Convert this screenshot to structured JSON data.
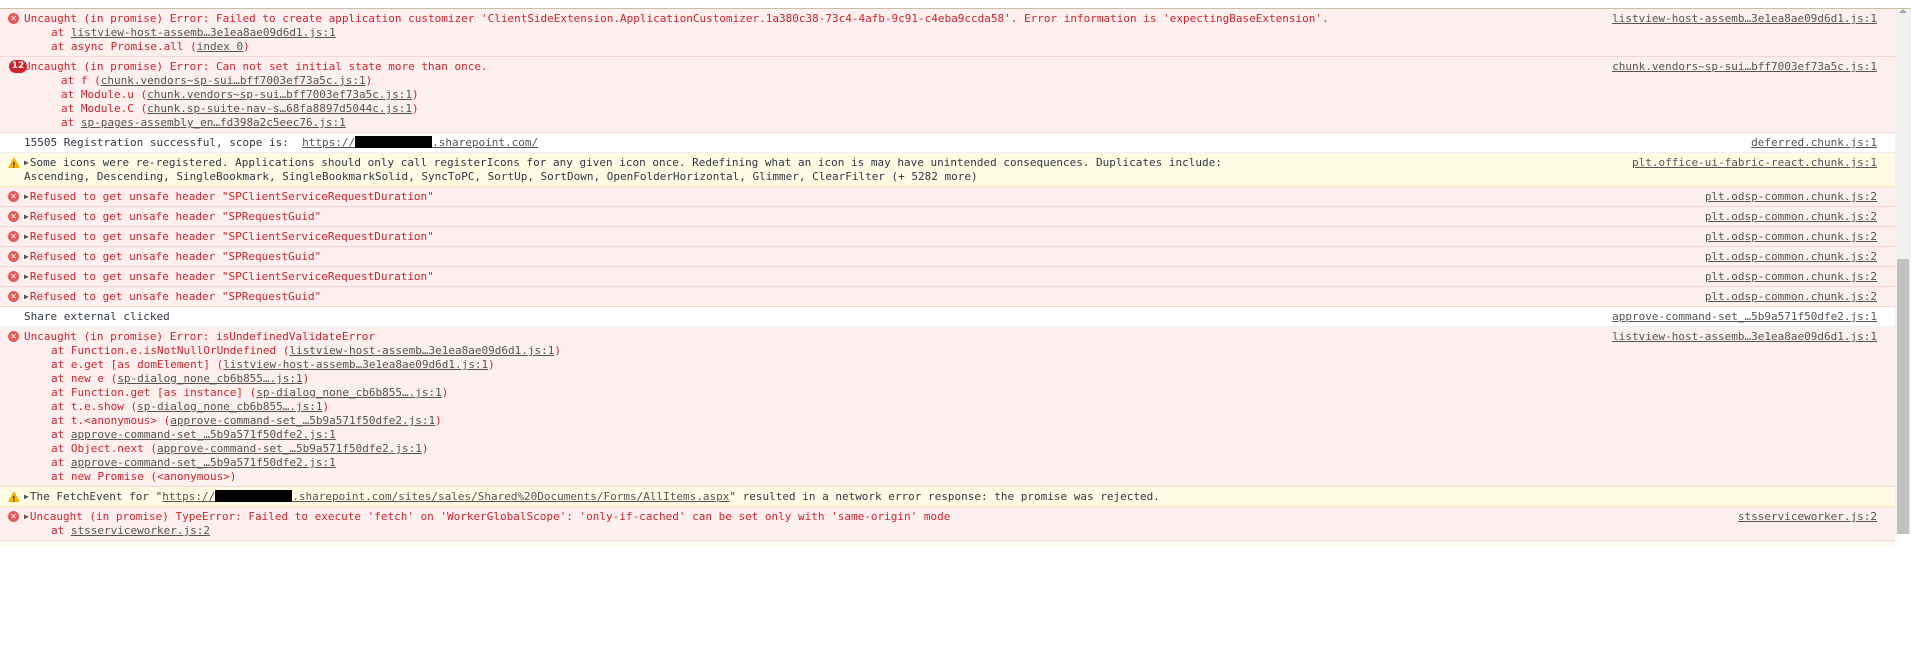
{
  "console": {
    "entries": [
      {
        "level": "error",
        "message": "Uncaught (in promise) Error: Failed to create application customizer 'ClientSideExtension.ApplicationCustomizer.1a380c38-73c4-4afb-9c91-c4eba9ccda58'. Error information is 'expectingBaseExtension'.",
        "source": "listview-host-assemb…3e1ea8ae09d6d1.js:1",
        "stack": [
          {
            "prefix": "at ",
            "link": "listview-host-assemb…3e1ea8ae09d6d1.js:1",
            "suffix": ""
          },
          {
            "prefix": "at async Promise.all (",
            "link": "index 0",
            "suffix": ")"
          }
        ]
      },
      {
        "level": "error",
        "count": "12",
        "message": "Uncaught (in promise) Error: Can not set initial state more than once.",
        "source": "chunk.vendors~sp-sui…bff7003ef73a5c.js:1",
        "stack": [
          {
            "prefix": "at f (",
            "link": "chunk.vendors~sp-sui…bff7003ef73a5c.js:1",
            "suffix": ")"
          },
          {
            "prefix": "at Module.u (",
            "link": "chunk.vendors~sp-sui…bff7003ef73a5c.js:1",
            "suffix": ")"
          },
          {
            "prefix": "at Module.C (",
            "link": "chunk.sp-suite-nav-s…68fa8897d5044c.js:1",
            "suffix": ")"
          },
          {
            "prefix": "at ",
            "link": "sp-pages-assembly_en…fd398a2c5eec76.js:1",
            "suffix": ""
          }
        ]
      },
      {
        "level": "info",
        "message_prefix": "15505 Registration successful, scope is:  ",
        "link_start": "https://",
        "link_end": ".sharepoint.com/",
        "source": "deferred.chunk.js:1"
      },
      {
        "level": "warning",
        "message": "Some icons were re-registered. Applications should only call registerIcons for any given icon once. Redefining what an icon is may have unintended consequences. Duplicates include:",
        "message_line2": "Ascending, Descending, SingleBookmark, SingleBookmarkSolid, SyncToPC, SortUp, SortDown, OpenFolderHorizontal, Glimmer, ClearFilter (+ 5282 more)",
        "source": "plt.office-ui-fabric-react.chunk.js:1"
      },
      {
        "level": "error",
        "message": "Refused to get unsafe header \"SPClientServiceRequestDuration\"",
        "source": "plt.odsp-common.chunk.js:2"
      },
      {
        "level": "error",
        "message": "Refused to get unsafe header \"SPRequestGuid\"",
        "source": "plt.odsp-common.chunk.js:2"
      },
      {
        "level": "error",
        "message": "Refused to get unsafe header \"SPClientServiceRequestDuration\"",
        "source": "plt.odsp-common.chunk.js:2"
      },
      {
        "level": "error",
        "message": "Refused to get unsafe header \"SPRequestGuid\"",
        "source": "plt.odsp-common.chunk.js:2"
      },
      {
        "level": "error",
        "message": "Refused to get unsafe header \"SPClientServiceRequestDuration\"",
        "source": "plt.odsp-common.chunk.js:2"
      },
      {
        "level": "error",
        "message": "Refused to get unsafe header \"SPRequestGuid\"",
        "source": "plt.odsp-common.chunk.js:2"
      },
      {
        "level": "info",
        "message": "Share external clicked",
        "source": "approve-command-set_…5b9a571f50dfe2.js:1"
      },
      {
        "level": "error",
        "message": "Uncaught (in promise) Error: isUndefinedValidateError",
        "source": "listview-host-assemb…3e1ea8ae09d6d1.js:1",
        "stack": [
          {
            "prefix": "at Function.e.isNotNullOrUndefined (",
            "link": "listview-host-assemb…3e1ea8ae09d6d1.js:1",
            "suffix": ")"
          },
          {
            "prefix": "at e.get [as domElement] (",
            "link": "listview-host-assemb…3e1ea8ae09d6d1.js:1",
            "suffix": ")"
          },
          {
            "prefix": "at new e (",
            "link": "sp-dialog_none_cb6b855….js:1",
            "suffix": ")"
          },
          {
            "prefix": "at Function.get [as instance] (",
            "link": "sp-dialog_none_cb6b855….js:1",
            "suffix": ")"
          },
          {
            "prefix": "at t.e.show (",
            "link": "sp-dialog_none_cb6b855….js:1",
            "suffix": ")"
          },
          {
            "prefix": "at t.<anonymous> (",
            "link": "approve-command-set_…5b9a571f50dfe2.js:1",
            "suffix": ")"
          },
          {
            "prefix": "at ",
            "link": "approve-command-set_…5b9a571f50dfe2.js:1",
            "suffix": ""
          },
          {
            "prefix": "at Object.next (",
            "link": "approve-command-set_…5b9a571f50dfe2.js:1",
            "suffix": ")"
          },
          {
            "prefix": "at ",
            "link": "approve-command-set_…5b9a571f50dfe2.js:1",
            "suffix": ""
          },
          {
            "prefix": "at new Promise (<anonymous>)",
            "link": "",
            "suffix": ""
          }
        ]
      },
      {
        "level": "warning",
        "message_prefix": "The FetchEvent for \"",
        "link_start": "https://",
        "link_end": ".sharepoint.com/sites/sales/Shared%20Documents/Forms/AllItems.aspx",
        "message_suffix": "\" resulted in a network error response: the promise was rejected.",
        "source": ""
      },
      {
        "level": "error",
        "message": "Uncaught (in promise) TypeError: Failed to execute 'fetch' on 'WorkerGlobalScope': 'only-if-cached' can be set only with 'same-origin' mode",
        "source": "stsserviceworker.js:2",
        "stack": [
          {
            "prefix": "at ",
            "link": "stsserviceworker.js:2",
            "suffix": ""
          }
        ]
      }
    ]
  },
  "icons": {
    "error": "error-circle-x-icon",
    "warning": "warning-triangle-icon",
    "expand": "expand-triangle-icon"
  },
  "colors": {
    "error_text": "#d0232c",
    "error_bg": "#fff0f0",
    "warning_bg": "#fffbe5",
    "warning_icon": "#f2b600",
    "badge_bg": "#d0232c"
  }
}
